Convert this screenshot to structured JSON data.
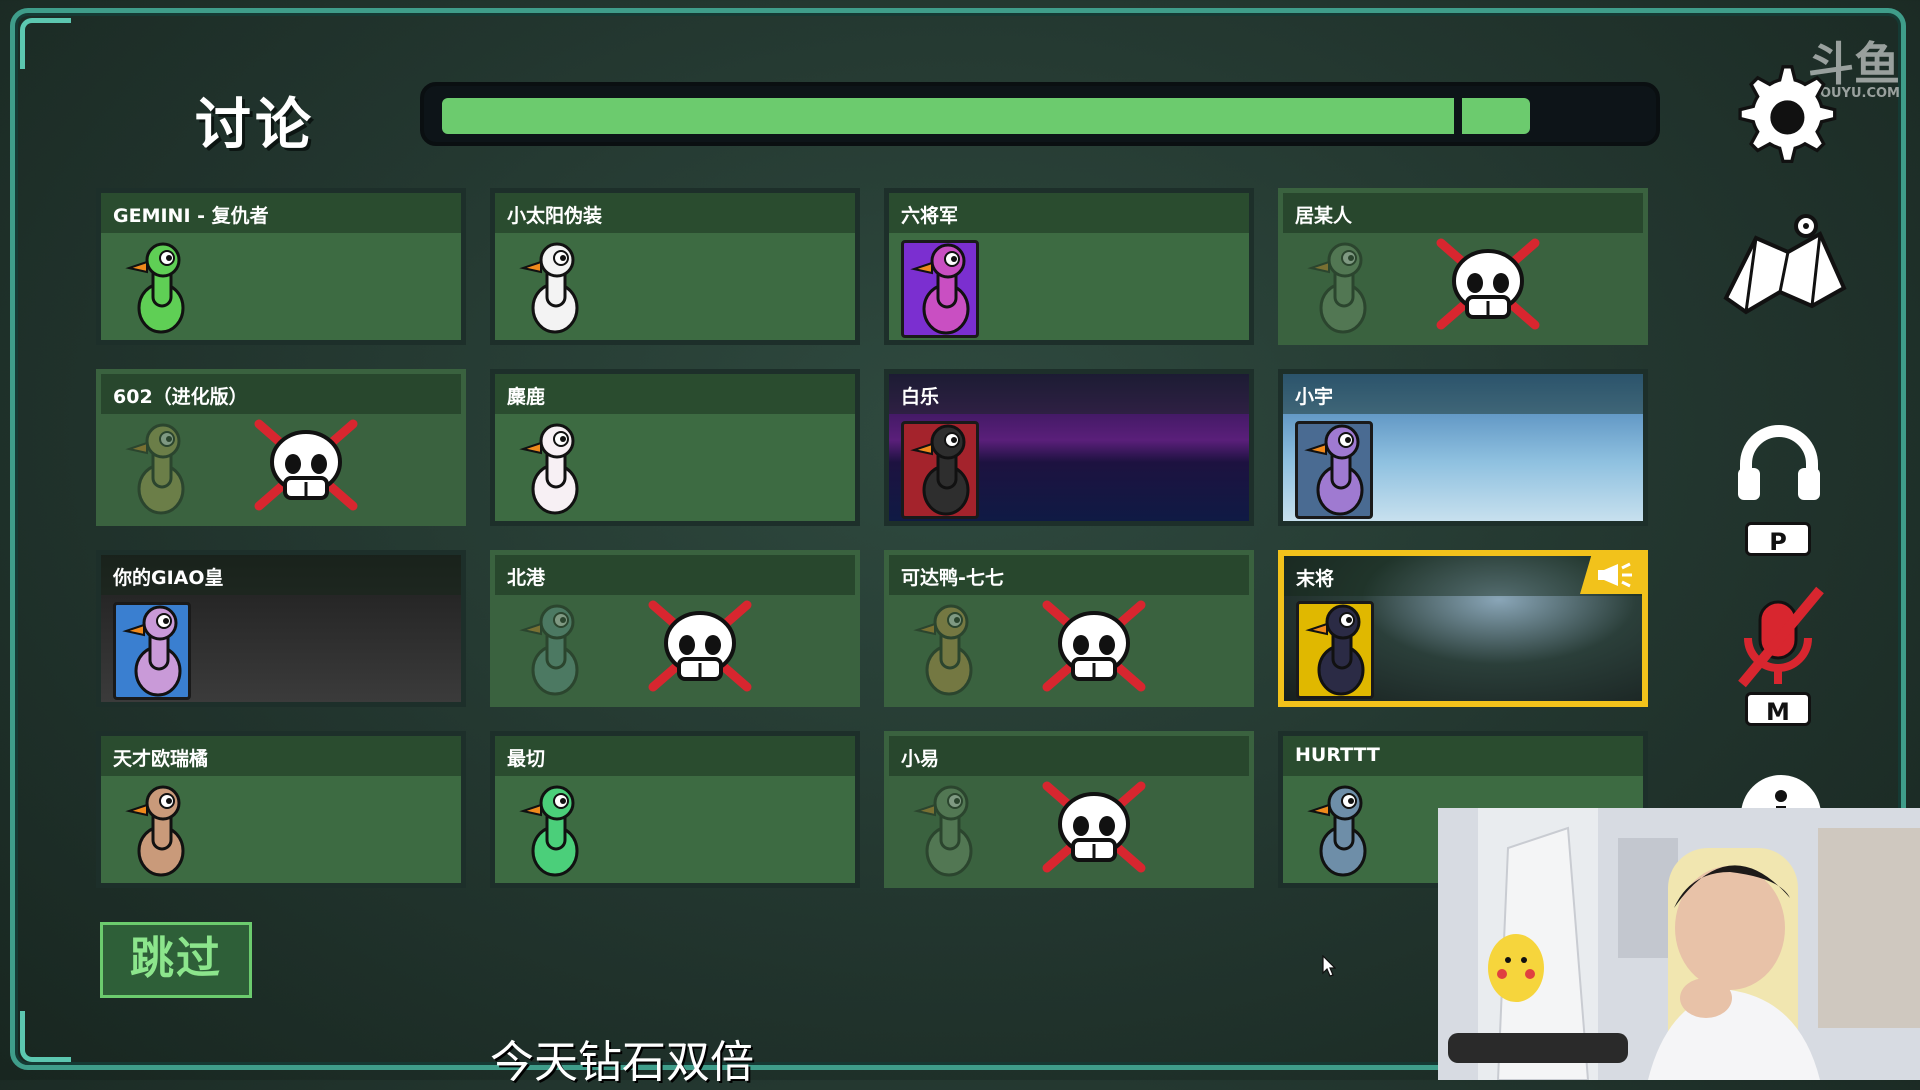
{
  "screen": {
    "title": "讨论",
    "timer_progress": 0.91
  },
  "watermark": {
    "brand": "斗鱼",
    "site": "DOUYU.COM"
  },
  "players": [
    {
      "name": "GEMINI - 复仇者",
      "status": "alive",
      "color": "#5fcf55"
    },
    {
      "name": "小太阳伪装",
      "status": "alive",
      "color": "#f3f3f3"
    },
    {
      "name": "六将军",
      "status": "alive",
      "color": "#c94fc2"
    },
    {
      "name": "居某人",
      "status": "dead",
      "color": "#7fa07a"
    },
    {
      "name": "602（进化版）",
      "status": "dead",
      "color": "#c7b45a"
    },
    {
      "name": "麋鹿",
      "status": "alive",
      "color": "#f7f0f4"
    },
    {
      "name": "白乐",
      "status": "alive",
      "color": "#2e2e2e"
    },
    {
      "name": "小宇",
      "status": "alive",
      "color": "#9f7ad1"
    },
    {
      "name": "你的GIAO皇",
      "status": "alive",
      "color": "#c99ad8"
    },
    {
      "name": "北港",
      "status": "dead",
      "color": "#6fa6a3"
    },
    {
      "name": "可达鸭-七七",
      "status": "dead",
      "color": "#e0a24a"
    },
    {
      "name": "末将",
      "status": "speaking",
      "color": "#2b2b45"
    },
    {
      "name": "天才欧瑞橘",
      "status": "alive",
      "color": "#c99a7a"
    },
    {
      "name": "最切",
      "status": "alive",
      "color": "#4bcf7a"
    },
    {
      "name": "小易",
      "status": "dead",
      "color": "#7fa07a"
    },
    {
      "name": "HURTTT",
      "status": "alive",
      "color": "#6e8ea8"
    }
  ],
  "sidebar": {
    "push_to_talk_key": "P",
    "mute_key": "M"
  },
  "skip_button": {
    "label": "跳过"
  },
  "caption": "今天钻石双倍",
  "colors": {
    "accent_teal": "#3f9d8a",
    "card_green": "#3d6b42",
    "timer_green": "#6ccb6e",
    "speaker_yellow": "#f2c21b",
    "dead_red": "#e02836"
  }
}
